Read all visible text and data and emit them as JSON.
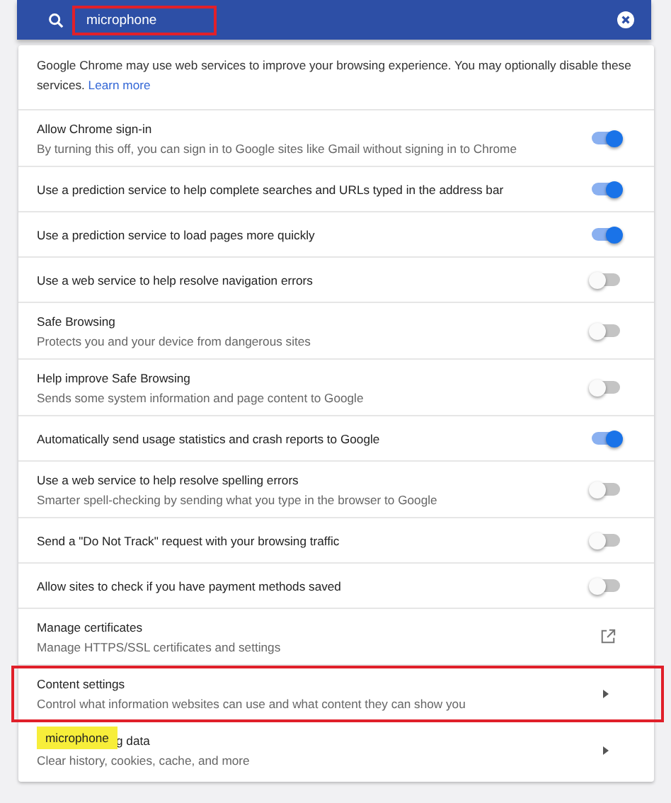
{
  "search": {
    "value": "microphone",
    "highlighted": true
  },
  "intro": {
    "text": "Google Chrome may use web services to improve your browsing experience. You may optionally disable these services.",
    "link": "Learn more"
  },
  "rows": [
    {
      "kind": "toggle",
      "title": "Allow Chrome sign-in",
      "subtitle": "By turning this off, you can sign in to Google sites like Gmail without signing in to Chrome",
      "on": true,
      "highlighted": false
    },
    {
      "kind": "toggle",
      "title": "Use a prediction service to help complete searches and URLs typed in the address bar",
      "on": true,
      "highlighted": false
    },
    {
      "kind": "toggle",
      "title": "Use a prediction service to load pages more quickly",
      "on": true,
      "highlighted": false
    },
    {
      "kind": "toggle",
      "title": "Use a web service to help resolve navigation errors",
      "on": false,
      "highlighted": false
    },
    {
      "kind": "toggle",
      "title": "Safe Browsing",
      "subtitle": "Protects you and your device from dangerous sites",
      "on": false,
      "highlighted": false
    },
    {
      "kind": "toggle",
      "title": "Help improve Safe Browsing",
      "subtitle": "Sends some system information and page content to Google",
      "on": false,
      "highlighted": false
    },
    {
      "kind": "toggle",
      "title": "Automatically send usage statistics and crash reports to Google",
      "on": true,
      "highlighted": false
    },
    {
      "kind": "toggle",
      "title": "Use a web service to help resolve spelling errors",
      "subtitle": "Smarter spell-checking by sending what you type in the browser to Google",
      "on": false,
      "highlighted": false
    },
    {
      "kind": "toggle",
      "title": "Send a \"Do Not Track\" request with your browsing traffic",
      "on": false,
      "highlighted": false
    },
    {
      "kind": "toggle",
      "title": "Allow sites to check if you have payment methods saved",
      "on": false,
      "highlighted": false
    },
    {
      "kind": "external",
      "title": "Manage certificates",
      "subtitle": "Manage HTTPS/SSL certificates and settings",
      "highlighted": false
    },
    {
      "kind": "arrow",
      "title": "Content settings",
      "subtitle": "Control what information websites can use and what content they can show you",
      "highlighted": true
    },
    {
      "kind": "arrow",
      "title": "g data",
      "subtitle": "Clear history, cookies, cache, and more",
      "highlighted": false,
      "search_bubble": "microphone"
    }
  ]
}
